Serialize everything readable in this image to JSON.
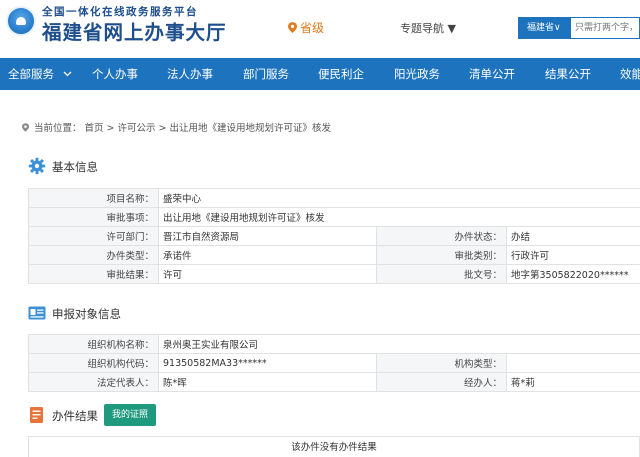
{
  "header": {
    "subtitle": "全国一体化在线政务服务平台",
    "title": "福建省网上办事大厅",
    "location": "省级",
    "nav_guide": "专题导航 ▼",
    "search_scope": "福建省∨",
    "search_placeholder": "只需打两个字，已"
  },
  "navbar": {
    "items": [
      "全部服务",
      "个人办事",
      "法人办事",
      "部门服务",
      "便民利企",
      "阳光政务",
      "清单公开",
      "结果公开",
      "效能"
    ]
  },
  "breadcrumb": "当前位置： 首页 > 许可公示 > 出让用地《建设用地规划许可证》核发",
  "basic_info": {
    "title": "基本信息",
    "project_name_label": "项目名称：",
    "project_name": "盛荣中心",
    "approval_item_label": "审批事项：",
    "approval_item": "出让用地《建设用地规划许可证》核发",
    "dept_label": "许可部门：",
    "dept": "晋江市自然资源局",
    "status_label": "办件状态：",
    "status": "办结",
    "case_type_label": "办件类型：",
    "case_type": "承诺件",
    "approval_category_label": "审批类别：",
    "approval_category": "行政许可",
    "result_label": "审批结果：",
    "result": "许可",
    "doc_no_label": "批文号：",
    "doc_no": "地字第3505822020******"
  },
  "applicant_info": {
    "title": "申报对象信息",
    "org_name_label": "组织机构名称：",
    "org_name": "泉州奥王实业有限公司",
    "org_code_label": "组织机构代码：",
    "org_code": "91350582MA33******",
    "org_type_label": "机构类型：",
    "org_type": "",
    "legal_rep_label": "法定代表人：",
    "legal_rep": "陈*晖",
    "handler_label": "经办人：",
    "handler": "蒋*莉"
  },
  "result_section": {
    "title": "办件结果",
    "my_cert_button": "我的证照",
    "empty_text": "该办件没有办件结果"
  },
  "colors": {
    "brand_blue": "#1e73be",
    "title_blue": "#1e4f8c",
    "location_orange": "#e07b1f",
    "button_green": "#1f9a7e"
  }
}
